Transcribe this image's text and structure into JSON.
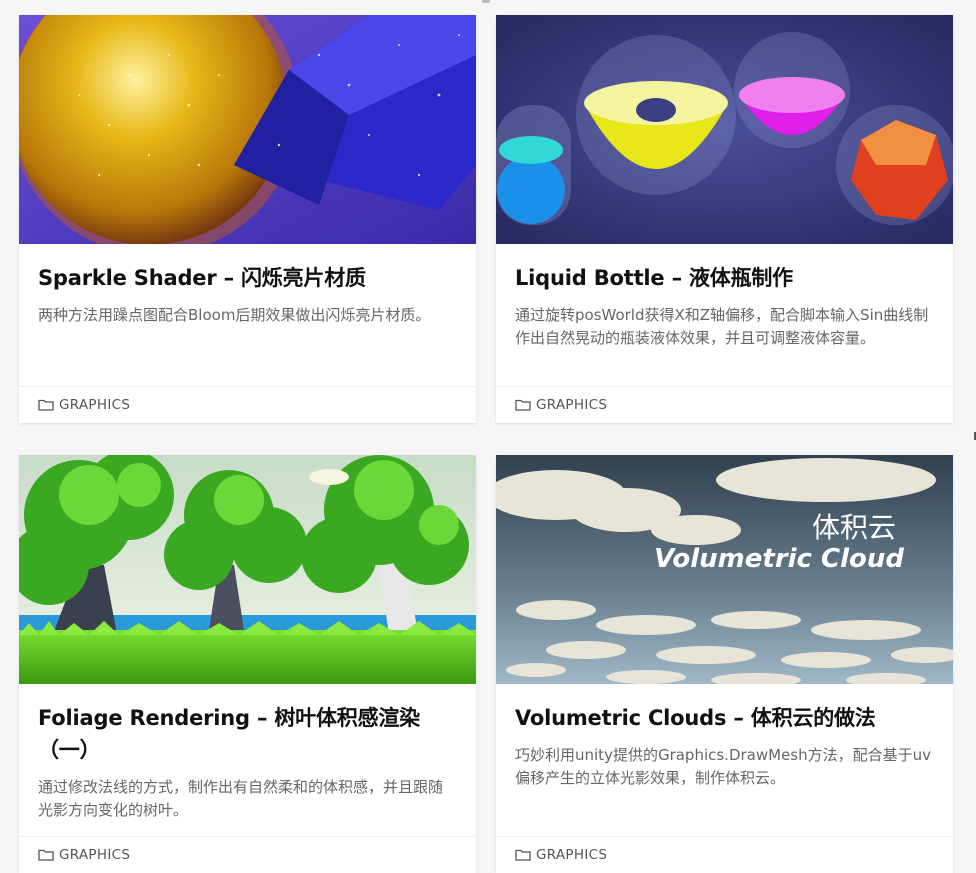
{
  "cards": [
    {
      "title": "Sparkle Shader – 闪烁亮片材质",
      "description": "两种方法用躁点图配合Bloom后期效果做出闪烁亮片材质。",
      "category": "GRAPHICS",
      "thumb_icon": "sparkle-sphere-cube-image"
    },
    {
      "title": "Liquid Bottle – 液体瓶制作",
      "description": "通过旋转posWorld获得X和Z轴偏移，配合脚本输入Sin曲线制作出自然晃动的瓶装液体效果，并且可调整液体容量。",
      "category": "GRAPHICS",
      "thumb_icon": "liquid-bottles-image"
    },
    {
      "title": "Foliage Rendering – 树叶体积感渲染（一）",
      "description": "通过修改法线的方式，制作出有自然柔和的体积感，并且跟随光影方向变化的树叶。",
      "category": "GRAPHICS",
      "thumb_icon": "stylized-trees-image"
    },
    {
      "title": "Volumetric Clouds – 体积云的做法",
      "description": "巧妙利用unity提供的Graphics.DrawMesh方法，配合基于uv偏移产生的立体光影效果，制作体积云。",
      "category": "GRAPHICS",
      "thumb_icon": "volumetric-cloud-image",
      "thumb_text_cn": "体积云",
      "thumb_text_en": "Volumetric Cloud"
    }
  ],
  "colors": {
    "page_bg": "#f6f6f6",
    "card_bg": "#ffffff",
    "title": "#111111",
    "description": "#666666",
    "category": "#555555"
  }
}
